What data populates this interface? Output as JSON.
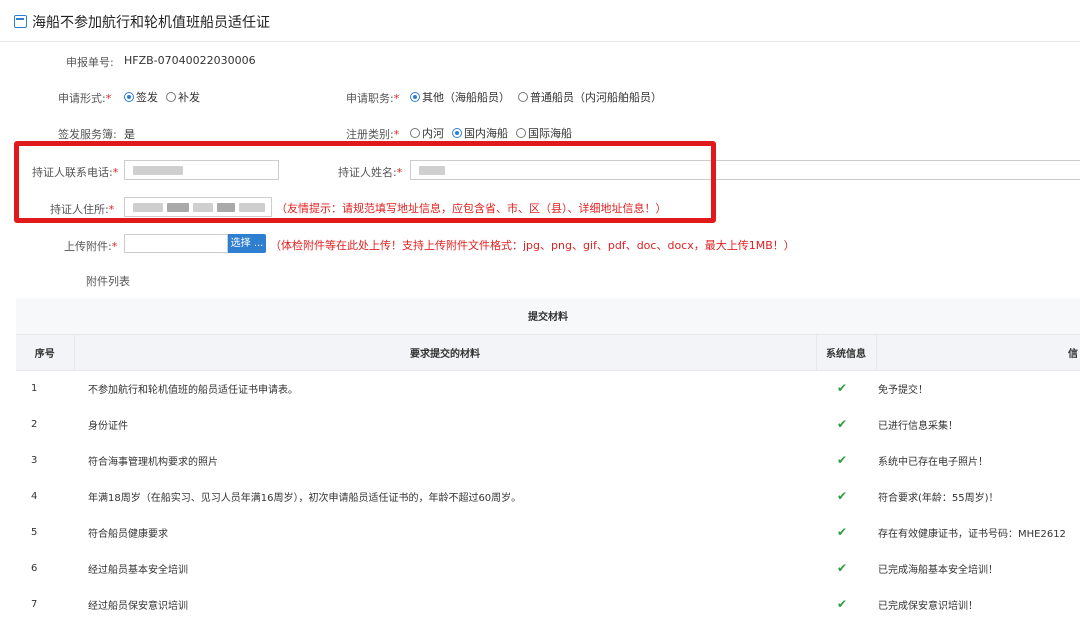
{
  "page": {
    "title": "海船不参加航行和轮机值班船员适任证"
  },
  "form": {
    "report_no": {
      "label": "申报单号:",
      "value": "HFZB-07040022030006"
    },
    "apply_form": {
      "label": "申请形式:",
      "required": "*",
      "options": [
        "签发",
        "补发"
      ],
      "selected": 0
    },
    "apply_position": {
      "label": "申请职务:",
      "required": "*",
      "options": [
        "其他（海船船员）",
        "普通船员（内河船舶船员）"
      ],
      "selected": 0
    },
    "service_book": {
      "label": "签发服务簿:",
      "value": "是"
    },
    "register_type": {
      "label": "注册类别:",
      "required": "*",
      "options": [
        "内河",
        "国内海船",
        "国际海船"
      ],
      "selected": 1
    },
    "holder_phone": {
      "label": "持证人联系电话:",
      "required": "*"
    },
    "holder_name": {
      "label": "持证人姓名:",
      "required": "*"
    },
    "holder_address": {
      "label": "持证人住所:",
      "required": "*",
      "hint": "（友情提示：请规范填写地址信息，应包含省、市、区（县）、详细地址信息！）"
    },
    "attachment": {
      "label": "上传附件:",
      "required": "*",
      "button": "选择 ...",
      "hint": "（体检附件等在此处上传！支持上传附件文件格式：jpg、png、gif、pdf、doc、docx，最大上传1MB！）"
    },
    "attachment_list_label": "附件列表"
  },
  "table": {
    "group_header": "提交材料",
    "headers": [
      "序号",
      "要求提交的材料",
      "系统信息",
      "信"
    ],
    "rows": [
      {
        "idx": "1",
        "material": "不参加航行和轮机值班的船员适任证书申请表。",
        "sys": "✔",
        "info": "免予提交！"
      },
      {
        "idx": "2",
        "material": "身份证件",
        "sys": "✔",
        "info": "已进行信息采集！"
      },
      {
        "idx": "3",
        "material": "符合海事管理机构要求的照片",
        "sys": "✔",
        "info": "系统中已存在电子照片！"
      },
      {
        "idx": "4",
        "material": "年满18周岁（在船实习、见习人员年满16周岁），初次申请船员适任证书的，年龄不超过60周岁。",
        "sys": "✔",
        "info": "符合要求(年龄：55周岁)！"
      },
      {
        "idx": "5",
        "material": "符合船员健康要求",
        "sys": "✔",
        "info": "存在有效健康证书，证书号码：MHE2612"
      },
      {
        "idx": "6",
        "material": "经过船员基本安全培训",
        "sys": "✔",
        "info": "已完成海船基本安全培训！"
      },
      {
        "idx": "7",
        "material": "经过船员保安意识培训",
        "sys": "✔",
        "info": "已完成保安意识培训！"
      }
    ]
  },
  "colors": {
    "accent": "#2f7fd1",
    "required": "#e02020",
    "check": "#2e9b3a",
    "highlight_box": "#e01a1a"
  }
}
